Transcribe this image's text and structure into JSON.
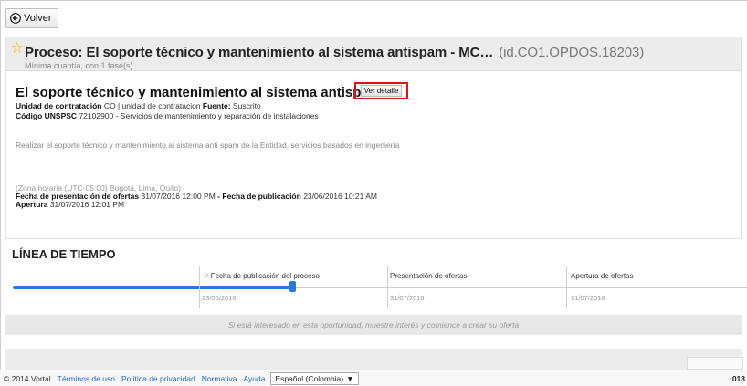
{
  "back_button": {
    "label": "Volver",
    "icon": "back-arrow-circle-icon"
  },
  "header": {
    "star_icon": "star-outline-icon",
    "title": "Proceso: El soporte técnico y mantenimiento al sistema antispam - MC…",
    "id": "(id.CO1.OPDOS.18203)",
    "subtitle": "Mínima cuantía, con 1 fase(s)"
  },
  "detail": {
    "title": "El soporte técnico y mantenimiento al sistema antispam",
    "ver_detalle": "Ver detalle",
    "unidad_label": "Unidad de contratación",
    "unidad_value": "CO | unidad de contratacion",
    "fuente_label": "Fuente:",
    "fuente_value": "Suscrito",
    "unspsc_label": "Código UNSPSC",
    "unspsc_value": "72102900 - Servicios de mantenimiento y reparación de instalaciones",
    "description": "Realizar el soporte técnico y mantenimiento al sistema anti spam de la Entidad, servicios basados en ingeniería",
    "timezone": "(Zona horaria (UTC-05:00) Bogotá, Lima, Quito)",
    "presentacion_label": "Fecha de presentación de ofertas",
    "presentacion_value": "31/07/2016 12:00 PM",
    "dash": "-",
    "publicacion_label": "Fecha de publicación",
    "publicacion_value": "23/06/2016 10:21 AM",
    "apertura_label": "Apertura",
    "apertura_value": "31/07/2016 12:01 PM"
  },
  "timeline": {
    "title": "LÍNEA DE TIEMPO",
    "progress": 0.38,
    "stages": [
      {
        "label": "Fecha de publicación del proceso",
        "date": "23/06/2016",
        "done": true
      },
      {
        "label": "Presentación de ofertas",
        "date": "31/07/2016",
        "done": false
      },
      {
        "label": "Apertura de ofertas",
        "date": "31/07/2016",
        "done": false
      }
    ]
  },
  "interest_message": "Si está interesado en esta oportunidad, muestre interés y comience a crear su oferta",
  "footer": {
    "copyright": "© 2014 Vortal",
    "links": [
      "Términos de uso",
      "Política de privacidad",
      "Normativa",
      "Ayuda"
    ],
    "language": "Español (Colombia)",
    "code": "018"
  },
  "colors": {
    "accent": "#2b78d6",
    "highlight_border": "#d6161b",
    "link": "#1e66c5",
    "star": "#f0b400"
  }
}
